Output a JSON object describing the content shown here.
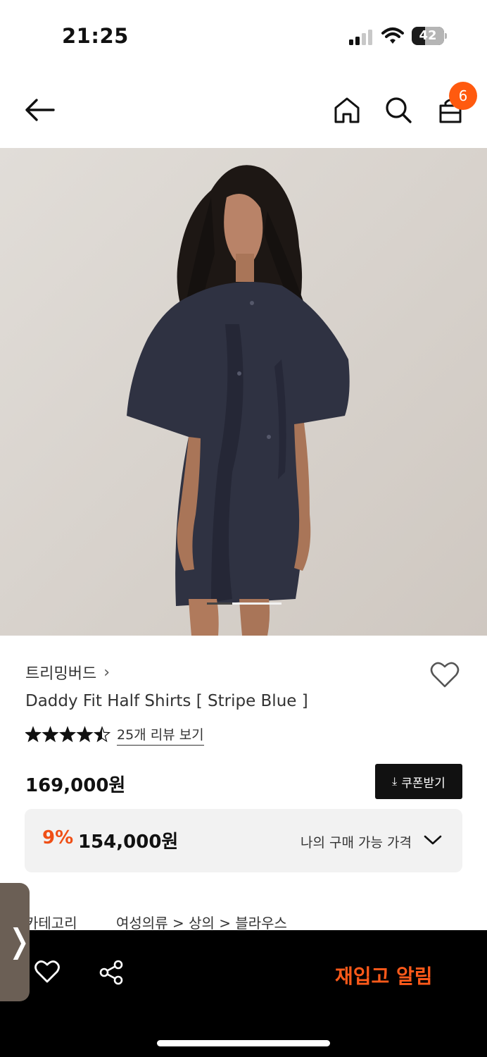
{
  "status": {
    "time": "21:25",
    "battery": "42",
    "battery_level": 0.42
  },
  "nav": {
    "cart_count": "6"
  },
  "gallery": {
    "active_slide": 1,
    "slide_count": 3
  },
  "product": {
    "brand": "트리밍버드",
    "brand_chevron": "›",
    "name": "Daddy Fit Half Shirts [ Stripe Blue ]",
    "rating": 4.5,
    "review_link": "25개 리뷰 보기",
    "price": "169,000원",
    "coupon_button": "쿠폰받기",
    "discount": "9%",
    "sale_price": "154,000원",
    "my_price_label": "나의 구매 가능 가격",
    "category_label": "카테고리",
    "category_path": "여성의류 > 상의 > 블라우스"
  },
  "bottom": {
    "restock_label": "재입고 알림"
  },
  "side_tab": {
    "arrow": "❭"
  },
  "colors": {
    "accent": "#ff5a0f",
    "discount": "#ef4f16",
    "dark": "#111111"
  }
}
